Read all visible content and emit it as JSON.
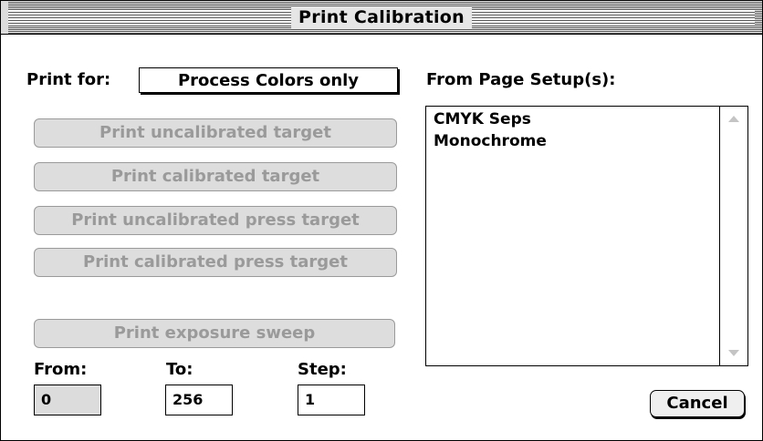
{
  "window": {
    "title": "Print Calibration"
  },
  "print_for": {
    "label": "Print for:",
    "value": "Process Colors only"
  },
  "buttons": {
    "print_uncalibrated_target": "Print uncalibrated target",
    "print_calibrated_target": "Print calibrated target",
    "print_uncalibrated_press_target": "Print uncalibrated press target",
    "print_calibrated_press_target": "Print calibrated press target",
    "print_exposure_sweep": "Print exposure sweep",
    "cancel": "Cancel"
  },
  "exposure": {
    "from_label": "From:",
    "from_value": "0",
    "to_label": "To:",
    "to_value": "256",
    "step_label": "Step:",
    "step_value": "1"
  },
  "page_setups": {
    "label": "From Page Setup(s):",
    "items": [
      "CMYK Seps",
      "Monochrome"
    ]
  },
  "icons": {
    "scroll_up": "scroll-up-arrow-icon",
    "scroll_down": "scroll-down-arrow-icon"
  },
  "colors": {
    "disabled_text": "#9a9a9a",
    "disabled_fill": "#dddddd"
  }
}
